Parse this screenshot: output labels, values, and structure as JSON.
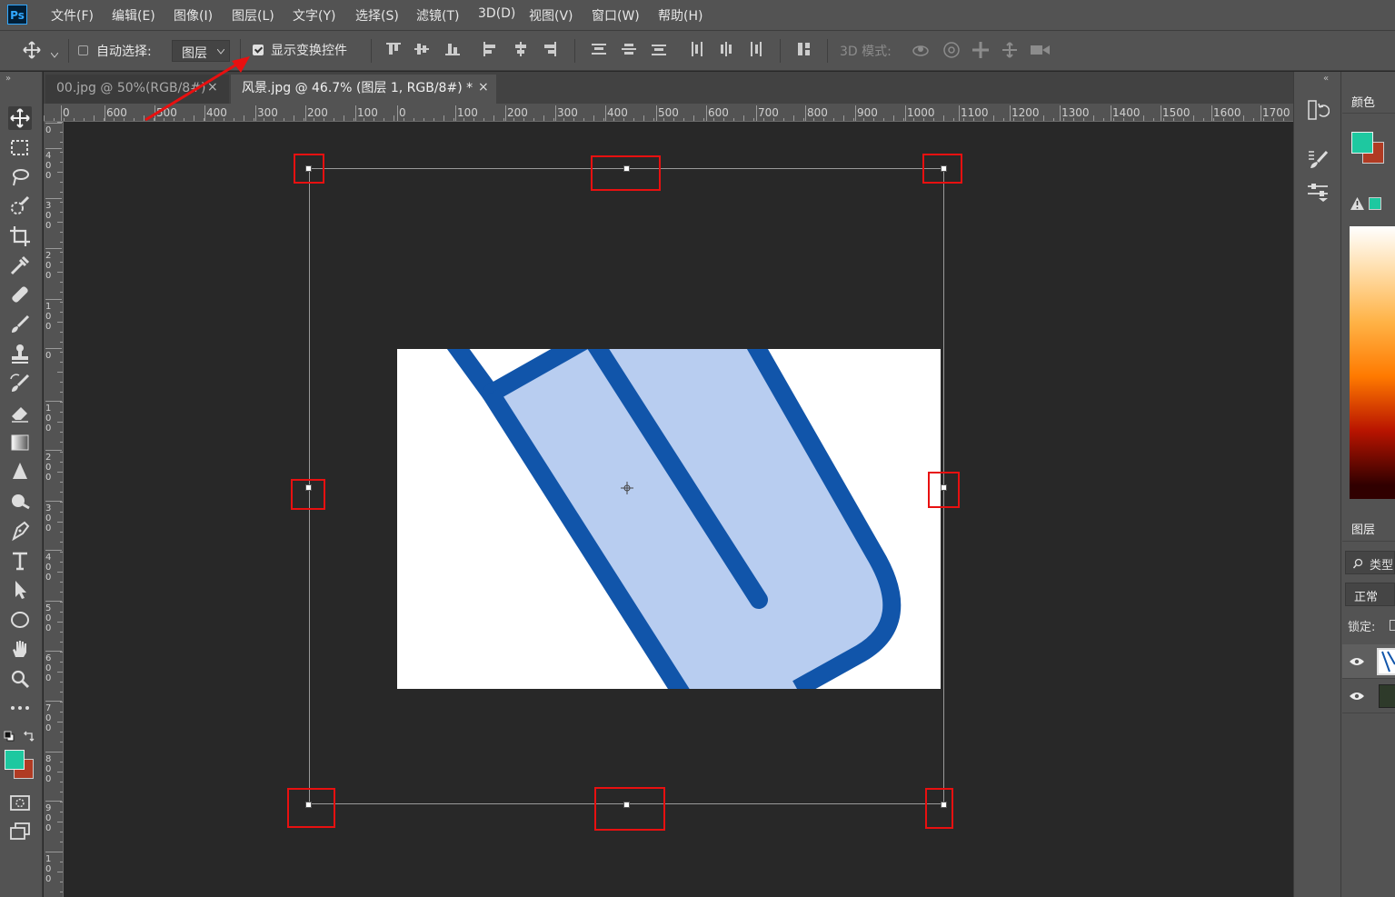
{
  "app": {
    "logo_text": "Ps",
    "menu": [
      "文件(F)",
      "编辑(E)",
      "图像(I)",
      "图层(L)",
      "文字(Y)",
      "选择(S)",
      "滤镜(T)",
      "3D(D)",
      "视图(V)",
      "窗口(W)",
      "帮助(H)"
    ]
  },
  "options_bar": {
    "auto_select_label": "自动选择:",
    "auto_select_checked": false,
    "layer_select_value": "图层",
    "show_transform_label": "显示变换控件",
    "show_transform_checked": true,
    "mode3d_label": "3D 模式:"
  },
  "tabs": [
    {
      "label": "00.jpg @ 50%(RGB/8#)",
      "close": "×",
      "active": false
    },
    {
      "label": "风景.jpg @ 46.7% (图层 1, RGB/8#) *",
      "close": "×",
      "active": true
    }
  ],
  "ruler_h": [
    "0",
    "600",
    "500",
    "400",
    "300",
    "200",
    "100",
    "0",
    "100",
    "200",
    "300",
    "400",
    "500",
    "600",
    "700",
    "800",
    "900",
    "1000",
    "1100",
    "1200",
    "1300",
    "1400",
    "1500",
    "1600",
    "1700"
  ],
  "ruler_v": [
    "0",
    "400",
    "300",
    "200",
    "100",
    "0",
    "100",
    "200",
    "300",
    "400",
    "500",
    "600",
    "700",
    "800",
    "900",
    "100"
  ],
  "panels": {
    "color_title": "颜色",
    "layers_title": "图层",
    "layer_filter_label": "类型",
    "blend_mode": "正常",
    "lock_label": "锁定:"
  },
  "colors": {
    "foreground": "#1ec8a0",
    "background": "#b03b23",
    "annotation": "#e81010",
    "image_stroke": "#1155aa",
    "image_fill": "#b8cdf0"
  }
}
